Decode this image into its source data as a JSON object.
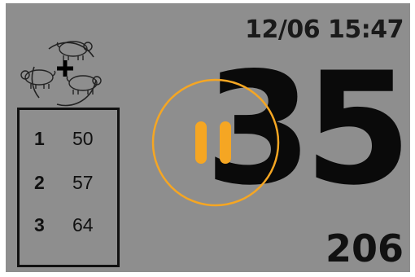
{
  "header": {
    "datetime": "12/06 15:47"
  },
  "counter": {
    "current": "35",
    "total": "206"
  },
  "list": [
    {
      "index": "1",
      "value": "50"
    },
    {
      "index": "2",
      "value": "57"
    },
    {
      "index": "3",
      "value": "64"
    }
  ],
  "controls": {
    "pause_icon": "pause-icon",
    "group_icon": "pig-group-add-icon"
  },
  "colors": {
    "screen_bg": "#8e8e8e",
    "accent": "#f5a623",
    "text": "#111111"
  }
}
